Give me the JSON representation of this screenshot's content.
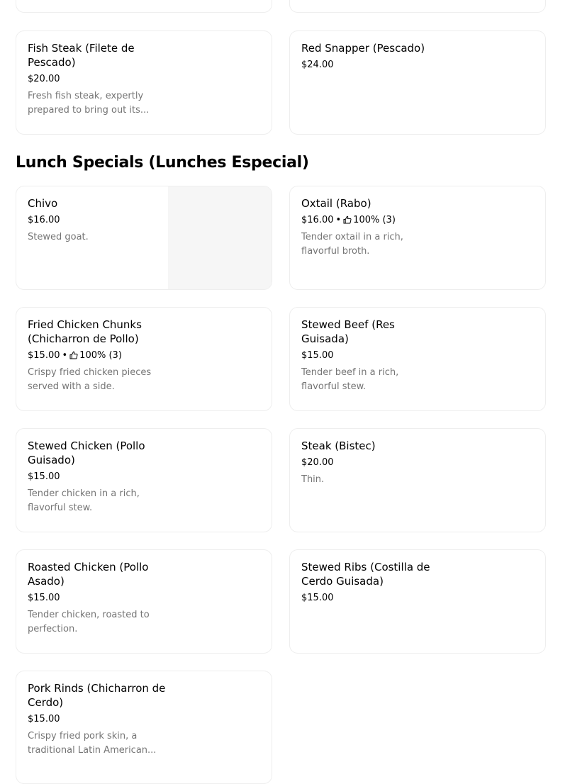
{
  "prev_section": {
    "items": [
      {
        "name": "Fish Steak (Filete de Pescado)",
        "price": "$20.00",
        "description": "Fresh fish steak, expertly prepared to bring out its..."
      },
      {
        "name": "Red Snapper (Pescado)",
        "price": "$24.00"
      }
    ]
  },
  "lunch_specials": {
    "heading": "Lunch Specials (Lunches Especial)",
    "items": [
      {
        "name": "Chivo",
        "price": "$16.00",
        "description": "Stewed goat."
      },
      {
        "name": "Oxtail (Rabo)",
        "price": "$16.00",
        "rating": "100% (3)",
        "description": "Tender oxtail in a rich, flavorful broth."
      },
      {
        "name": "Fried Chicken Chunks (Chicharron de Pollo)",
        "price": "$15.00",
        "rating": "100% (3)",
        "description": "Crispy fried chicken pieces served with a side."
      },
      {
        "name": "Stewed Beef (Res Guisada)",
        "price": "$15.00",
        "description": "Tender beef in a rich, flavorful stew."
      },
      {
        "name": "Stewed Chicken (Pollo Guisado)",
        "price": "$15.00",
        "description": "Tender chicken in a rich, flavorful stew."
      },
      {
        "name": "Steak (Bistec)",
        "price": "$20.00",
        "description": "Thin."
      },
      {
        "name": "Roasted Chicken (Pollo Asado)",
        "price": "$15.00",
        "description": "Tender chicken, roasted to perfection."
      },
      {
        "name": "Stewed Ribs (Costilla de Cerdo Guisada)",
        "price": "$15.00"
      },
      {
        "name": "Pork Rinds (Chicharron de Cerdo)",
        "price": "$15.00",
        "description": "Crispy fried pork skin, a traditional Latin American..."
      }
    ]
  },
  "separator": "•"
}
